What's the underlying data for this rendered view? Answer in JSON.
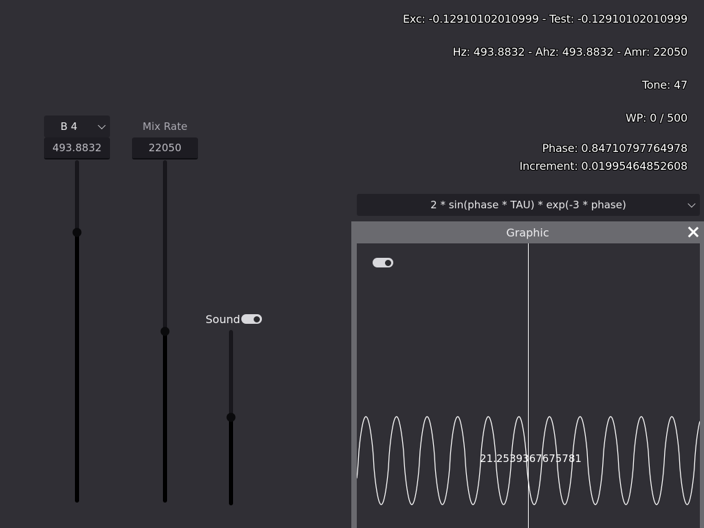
{
  "info": {
    "exc_test": "Exc: -0.12910102010999 - Test: -0.12910102010999",
    "hz_line": "Hz: 493.8832 - Ahz: 493.8832 - Amr: 22050",
    "tone": "Tone: 47",
    "wp": "WP: 0 / 500",
    "phase": "Phase: 0.84710797764978",
    "increment": "Increment: 0.01995464852608"
  },
  "note_select": {
    "value": "B 4",
    "icon": "chevron-down-icon"
  },
  "frequency_box": {
    "value": "493.8832"
  },
  "mix_rate": {
    "label": "Mix Rate",
    "value": "22050"
  },
  "sound": {
    "label": "Sound",
    "enabled": true
  },
  "sliders": {
    "frequency_level": 0.79,
    "mix_rate_level": 0.5,
    "sound_level": 0.5
  },
  "formula_select": {
    "value": "2 * sin(phase * TAU) * exp(-3 * phase)",
    "icon": "chevron-down-icon"
  },
  "graphic_window": {
    "title": "Graphic",
    "close_icon": "close-icon",
    "toggle_enabled": true,
    "readout": "21.2539367675781"
  },
  "colors": {
    "background": "#302f35",
    "waveform": "#ffffff",
    "window_frame": "#6a6a6f"
  }
}
